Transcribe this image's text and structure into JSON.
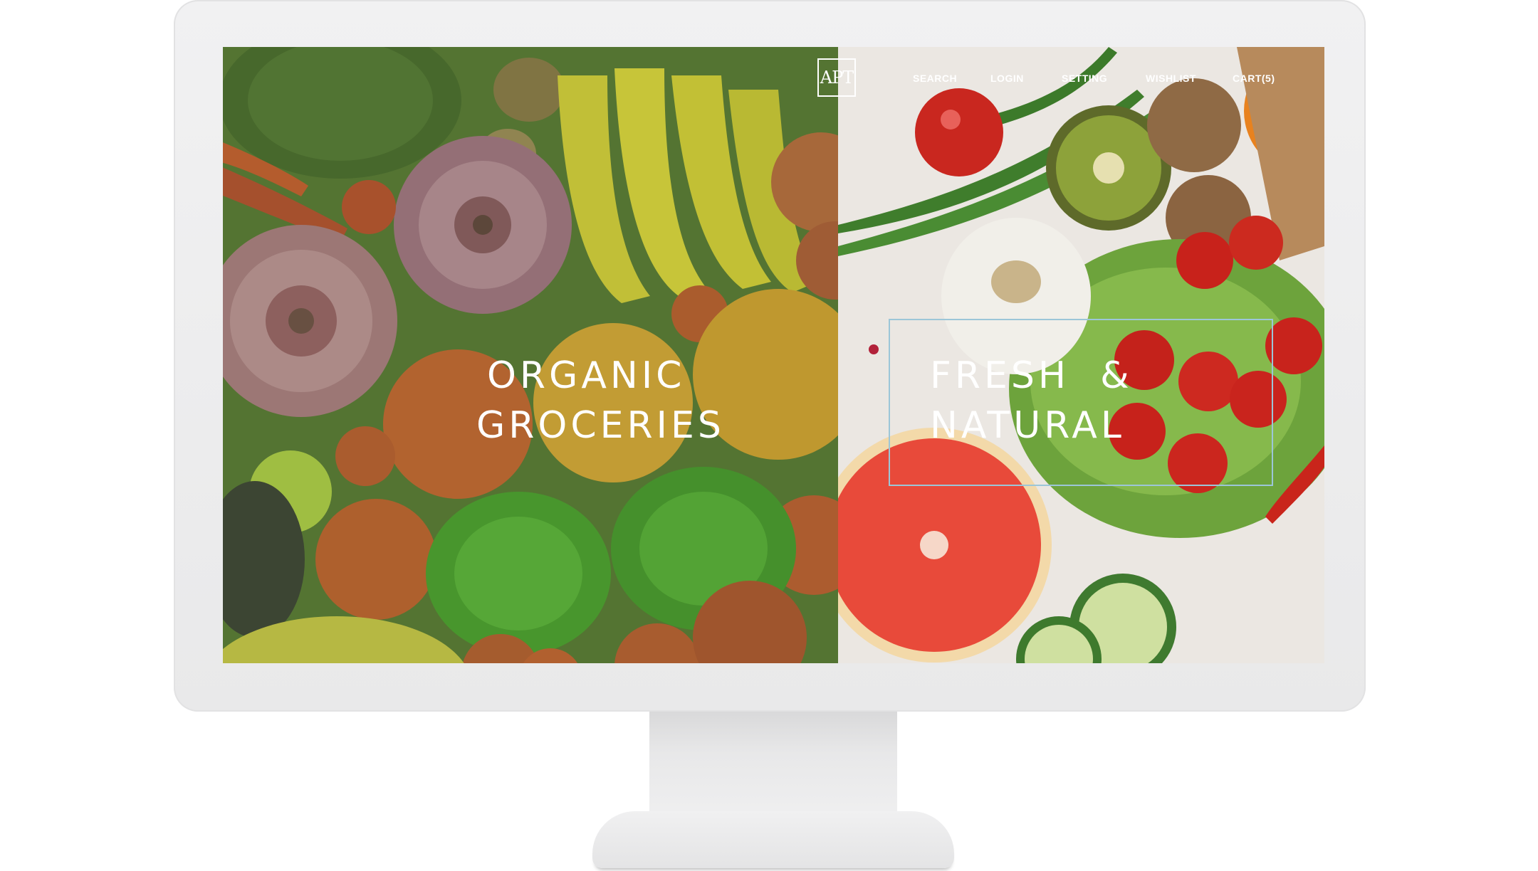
{
  "brand": {
    "logo_text": "APT"
  },
  "nav": {
    "items": [
      {
        "label": "SEARCH"
      },
      {
        "label": "LOGIN"
      },
      {
        "label": "SETTING"
      },
      {
        "label": "WISHLIST"
      },
      {
        "label": "CART(5)"
      }
    ]
  },
  "hero": {
    "left": {
      "line1": "ORGANIC",
      "line2": "GROCERIES"
    },
    "right": {
      "line1": "FRESH  &",
      "line2": "NATURAL"
    }
  },
  "colors": {
    "left_overlay": "#608c34",
    "frame_border": "#9cc6d8",
    "text": "#ffffff"
  }
}
